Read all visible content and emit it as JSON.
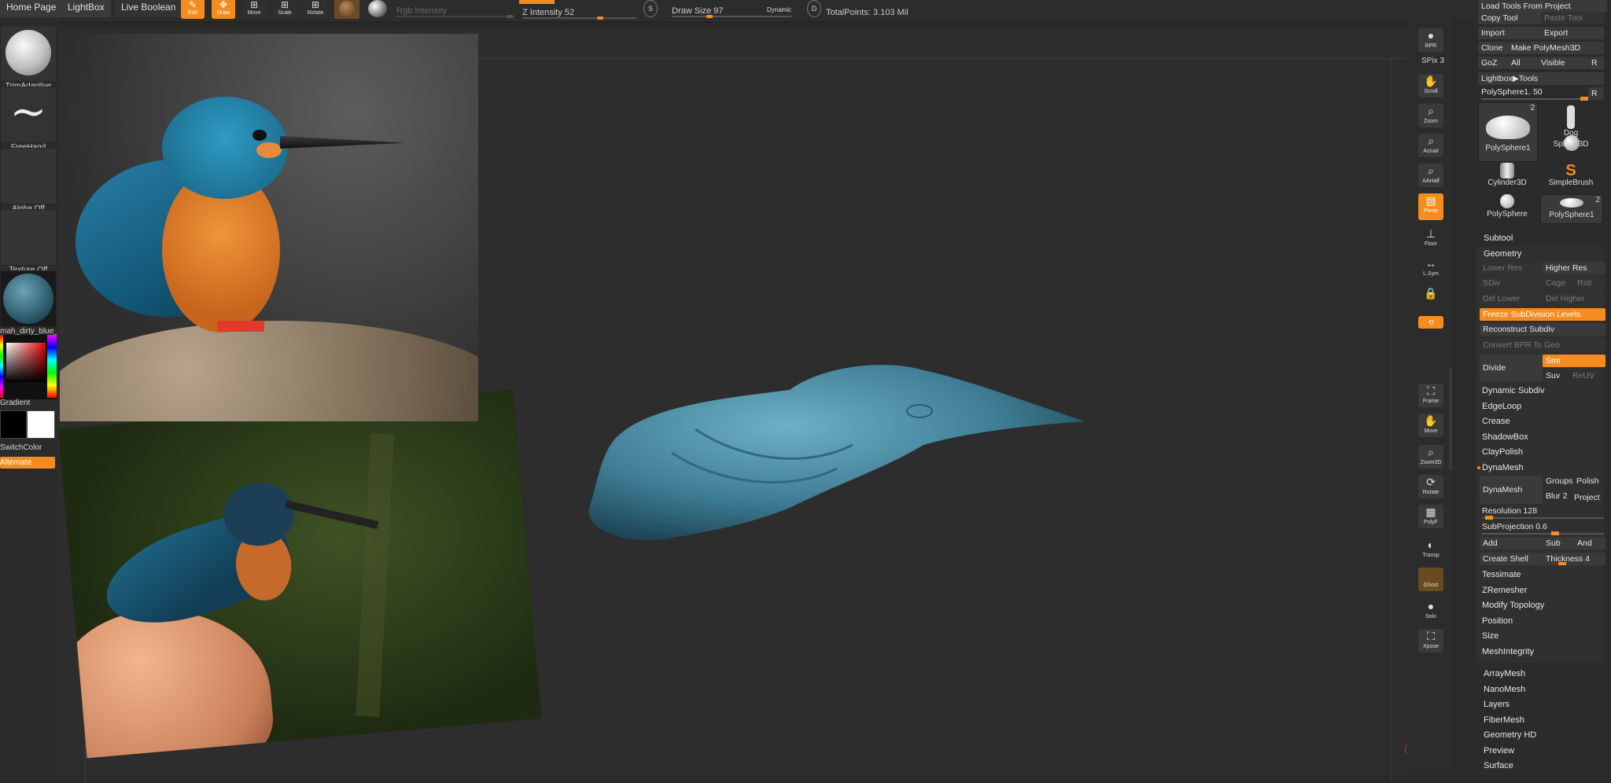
{
  "topbar": {
    "home_page": "Home Page",
    "lightbox": "LightBox",
    "live_boolean": "Live Boolean",
    "tools": [
      {
        "label": "Edit",
        "icon": "edit-icon",
        "active": true
      },
      {
        "label": "Draw",
        "icon": "draw-icon",
        "active": true
      },
      {
        "label": "Move",
        "icon": "move-icon",
        "active": false
      },
      {
        "label": "Scale",
        "icon": "scale-icon",
        "active": false
      },
      {
        "label": "Rotate",
        "icon": "rotate-icon",
        "active": false
      }
    ],
    "rgb_intensity": "Rgb Intensity",
    "z_intensity": "Z Intensity 52",
    "draw_size": "Draw Size 97",
    "dynamic": "Dynamic",
    "total_points": "TotalPoints: 3.103 Mil",
    "s_label": "S",
    "d_label": "D"
  },
  "left_shelf": {
    "brush": "TrimAdaptive",
    "stroke": "FreeHand",
    "alpha": "Alpha Off",
    "texture": "Texture Off",
    "material": "mah_dirty_blue_",
    "gradient": "Gradient",
    "switch_color": "SwitchColor",
    "alternate": "Alternate"
  },
  "right_shelf": [
    {
      "label": "BPR",
      "icon": "bpr-icon"
    },
    {
      "label": "SPix 3",
      "icon": ""
    },
    {
      "label": "Scroll",
      "icon": "scroll-icon"
    },
    {
      "label": "Zoom",
      "icon": "zoom-icon"
    },
    {
      "label": "Actual",
      "icon": "actual-icon"
    },
    {
      "label": "AAHalf",
      "icon": "aahalf-icon"
    },
    {
      "label": "Persp",
      "icon": "persp-icon"
    },
    {
      "label": "Floor",
      "icon": "floor-icon"
    },
    {
      "label": "L.Sym",
      "icon": "lsym-icon"
    },
    {
      "label": "",
      "icon": "lock-icon"
    },
    {
      "label": "XYZ",
      "icon": "xyz-icon"
    },
    {
      "label": "Frame",
      "icon": "frame-icon"
    },
    {
      "label": "Move",
      "icon": "move-icon"
    },
    {
      "label": "Zoom3D",
      "icon": "zoom3d-icon"
    },
    {
      "label": "Rotate",
      "icon": "rotate-icon"
    },
    {
      "label": "PolyF",
      "icon": "polyf-icon"
    },
    {
      "label": "Transp",
      "icon": "transp-icon"
    },
    {
      "label": "Ghost",
      "icon": "ghost-icon"
    },
    {
      "label": "Solo",
      "icon": "solo-icon"
    },
    {
      "label": "Xpose",
      "icon": "xpose-icon"
    }
  ],
  "panel": {
    "load_tools": "Load Tools From Project",
    "copy_tool": "Copy Tool",
    "paste_tool": "Paste Tool",
    "import": "Import",
    "export": "Export",
    "clone": "Clone",
    "make_polymesh": "Make PolyMesh3D",
    "goz": "GoZ",
    "all": "All",
    "visible": "Visible",
    "r": "R",
    "lightbox_tools": "Lightbox▶Tools",
    "polysphere_slider": "PolySphere1. 50",
    "tools": [
      {
        "name": "PolySphere1",
        "badge": "2"
      },
      {
        "name": "Dog",
        "badge": ""
      },
      {
        "name": "PolySphere1",
        "badge": ""
      },
      {
        "name": "Sphere3D",
        "badge": ""
      },
      {
        "name": "Cylinder3D",
        "badge": ""
      },
      {
        "name": "SimpleBrush",
        "badge": ""
      },
      {
        "name": "PolySphere",
        "badge": ""
      },
      {
        "name": "PolySphere1",
        "badge": "2"
      }
    ],
    "subtool": "Subtool",
    "geometry": "Geometry",
    "lower_res": "Lower Res",
    "higher_res": "Higher Res",
    "sdiv": "SDiv",
    "cage": "Cage",
    "rstr": "Rstr",
    "del_lower": "Del Lower",
    "del_higher": "Del Higher",
    "freeze_subdiv": "Freeze SubDivision Levels",
    "reconstruct_subdiv": "Reconstruct Subdiv",
    "convert_bpr": "Convert BPR To Geo",
    "divide": "Divide",
    "smt": "Smt",
    "suv": "Suv",
    "reuv": "ReUV",
    "dynamic_subdiv": "Dynamic Subdiv",
    "edgeloop": "EdgeLoop",
    "crease": "Crease",
    "shadowbox": "ShadowBox",
    "claypolish": "ClayPolish",
    "dynamesh_header": "DynaMesh",
    "dynamesh_btn": "DynaMesh",
    "groups": "Groups",
    "polish": "Polish",
    "blur": "Blur 2",
    "project": "Project",
    "resolution": "Resolution 128",
    "subprojection": "SubProjection 0.6",
    "add": "Add",
    "sub": "Sub",
    "and": "And",
    "create_shell": "Create Shell",
    "thickness": "Thickness 4",
    "tessimate": "Tessimate",
    "zremesher": "ZRemesher",
    "modify_topology": "Modify Topology",
    "position": "Position",
    "size": "Size",
    "meshintegrity": "MeshIntegrity",
    "arraymesh": "ArrayMesh",
    "nanomesh": "NanoMesh",
    "layers": "Layers",
    "fibermesh": "FiberMesh",
    "geometry_hd": "Geometry HD",
    "preview": "Preview",
    "surface": "Surface"
  },
  "colors": {
    "accent": "#f58c1f",
    "model": "#4f8ea6"
  }
}
